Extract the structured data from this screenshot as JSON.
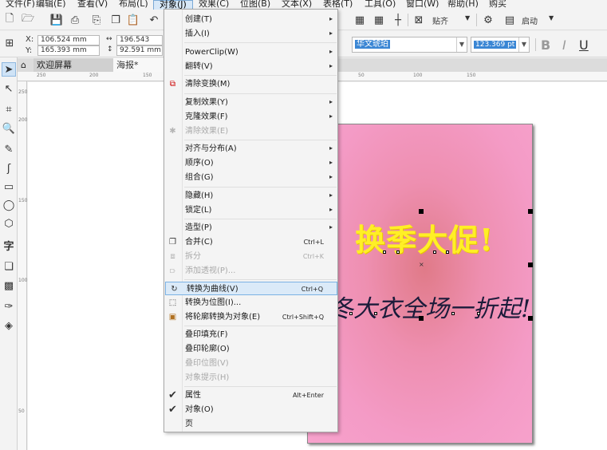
{
  "menubar": [
    {
      "label": "文件(F)"
    },
    {
      "label": "编辑(E)"
    },
    {
      "label": "查看(V)"
    },
    {
      "label": "布局(L)"
    },
    {
      "label": "对象(J)"
    },
    {
      "label": "效果(C)"
    },
    {
      "label": "位图(B)"
    },
    {
      "label": "文本(X)"
    },
    {
      "label": "表格(T)"
    },
    {
      "label": "工具(O)"
    },
    {
      "label": "窗口(W)"
    },
    {
      "label": "帮助(H)"
    },
    {
      "label": "购买"
    }
  ],
  "toolbar": {
    "snap_label": "贴齐",
    "launch_label": "启动"
  },
  "propbar": {
    "x_label": "X:",
    "y_label": "Y:",
    "x_value": "106.524 mm",
    "y_value": "165.393 mm",
    "w_value": "196.543 mm",
    "h_value": "92.591 mm",
    "font_name": "华文琥珀",
    "font_size": "123.369 pt",
    "bold": "B",
    "italic": "I",
    "underline": "U"
  },
  "tabs": {
    "welcome": "欢迎屏幕",
    "poster": "海报*"
  },
  "ruler": {
    "h": [
      "250",
      "200",
      "150",
      "50",
      "100",
      "150"
    ],
    "v": [
      "250",
      "200",
      "150",
      "100",
      "50"
    ]
  },
  "poster": {
    "headline": "换季大促!",
    "subline": "冬大衣全场一折起!"
  },
  "menu": {
    "items": [
      {
        "label": "创建(T)",
        "arrow": "▸"
      },
      {
        "label": "插入(I)",
        "arrow": "▸"
      },
      {
        "label": "PowerClip(W)",
        "arrow": "▸"
      },
      {
        "label": "翻转(V)",
        "arrow": "▸"
      },
      {
        "label": "清除变换(M)"
      },
      {
        "label": "复制效果(Y)",
        "arrow": "▸"
      },
      {
        "label": "克隆效果(F)",
        "arrow": "▸"
      },
      {
        "label": "清除效果(E)"
      },
      {
        "label": "对齐与分布(A)",
        "arrow": "▸"
      },
      {
        "label": "顺序(O)",
        "arrow": "▸"
      },
      {
        "label": "组合(G)",
        "arrow": "▸"
      },
      {
        "label": "隐藏(H)",
        "arrow": "▸"
      },
      {
        "label": "锁定(L)",
        "arrow": "▸"
      },
      {
        "label": "造型(P)",
        "arrow": "▸"
      },
      {
        "label": "合并(C)",
        "shortcut": "Ctrl+L"
      },
      {
        "label": "拆分",
        "shortcut": "Ctrl+K"
      },
      {
        "label": "添加透视(P)..."
      },
      {
        "label": "转换为曲线(V)",
        "shortcut": "Ctrl+Q"
      },
      {
        "label": "转换为位图(I)..."
      },
      {
        "label": "将轮廓转换为对象(E)",
        "shortcut": "Ctrl+Shift+Q"
      },
      {
        "label": "叠印填充(F)"
      },
      {
        "label": "叠印轮廓(O)"
      },
      {
        "label": "叠印位图(V)"
      },
      {
        "label": "对象提示(H)"
      },
      {
        "label": "属性",
        "shortcut": "Alt+Enter",
        "check": "✔"
      },
      {
        "label": "对象(O)",
        "check": "✔"
      },
      {
        "label": "页"
      }
    ]
  }
}
